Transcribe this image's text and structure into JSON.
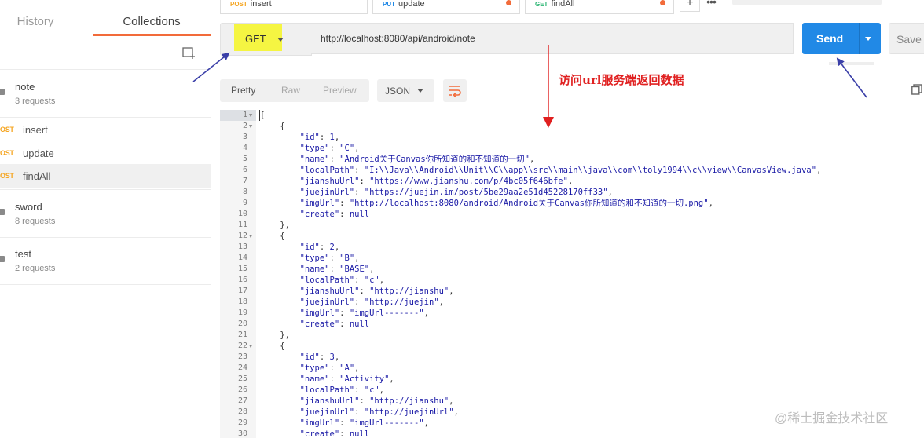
{
  "sidebar": {
    "tabs": [
      {
        "label": "History"
      },
      {
        "label": "Collections"
      }
    ],
    "collections": [
      {
        "name": "note",
        "sub": "3 requests",
        "requests": [
          {
            "method": "OST",
            "label": "insert"
          },
          {
            "method": "OST",
            "label": "update"
          },
          {
            "method": "OST",
            "label": "findAll"
          }
        ]
      },
      {
        "name": "sword",
        "sub": "8 requests"
      },
      {
        "name": "test",
        "sub": "2 requests"
      }
    ]
  },
  "top_tabs": [
    {
      "method": "POST",
      "label": "insert",
      "method_color": "#f5a623"
    },
    {
      "method": "PUT",
      "label": "update",
      "method_color": "#2189e6"
    },
    {
      "method": "GET",
      "label": "findAll",
      "method_color": "#2bb673"
    }
  ],
  "request": {
    "method": "GET",
    "url": "http://localhost:8080/api/android/note",
    "send_label": "Send",
    "save_label": "Save"
  },
  "response": {
    "formats": [
      "Pretty",
      "Raw",
      "Preview"
    ],
    "language": "JSON",
    "lines": [
      "[",
      "    {",
      "        \"id\": 1,",
      "        \"type\": \"C\",",
      "        \"name\": \"Android关于Canvas你所知道的和不知道的一切\",",
      "        \"localPath\": \"I:\\\\Java\\\\Android\\\\Unit\\\\C\\\\app\\\\src\\\\main\\\\java\\\\com\\\\toly1994\\\\c\\\\view\\\\CanvasView.java\",",
      "        \"jianshuUrl\": \"https://www.jianshu.com/p/4bc05f646bfe\",",
      "        \"juejinUrl\": \"https://juejin.im/post/5be29aa2e51d45228170ff33\",",
      "        \"imgUrl\": \"http://localhost:8080/android/Android关于Canvas你所知道的和不知道的一切.png\",",
      "        \"create\": null",
      "    },",
      "    {",
      "        \"id\": 2,",
      "        \"type\": \"B\",",
      "        \"name\": \"BASE\",",
      "        \"localPath\": \"c\",",
      "        \"jianshuUrl\": \"http://jianshu\",",
      "        \"juejinUrl\": \"http://juejin\",",
      "        \"imgUrl\": \"imgUrl-------\",",
      "        \"create\": null",
      "    },",
      "    {",
      "        \"id\": 3,",
      "        \"type\": \"A\",",
      "        \"name\": \"Activity\",",
      "        \"localPath\": \"c\",",
      "        \"jianshuUrl\": \"http://jianshu\",",
      "        \"juejinUrl\": \"http://juejinUrl\",",
      "        \"imgUrl\": \"imgUrl-------\",",
      "        \"create\": null"
    ],
    "fold_lines": [
      1,
      2,
      12,
      22
    ]
  },
  "annotation": {
    "text": "访问url服务端返回数据",
    "arrow_color": "#3a3fa8",
    "red_color": "#e02020"
  },
  "watermark": "@稀土掘金技术社区",
  "colors": {
    "accent": "#f26b3a",
    "send": "#2189e6",
    "highlight": "#f5f542"
  }
}
